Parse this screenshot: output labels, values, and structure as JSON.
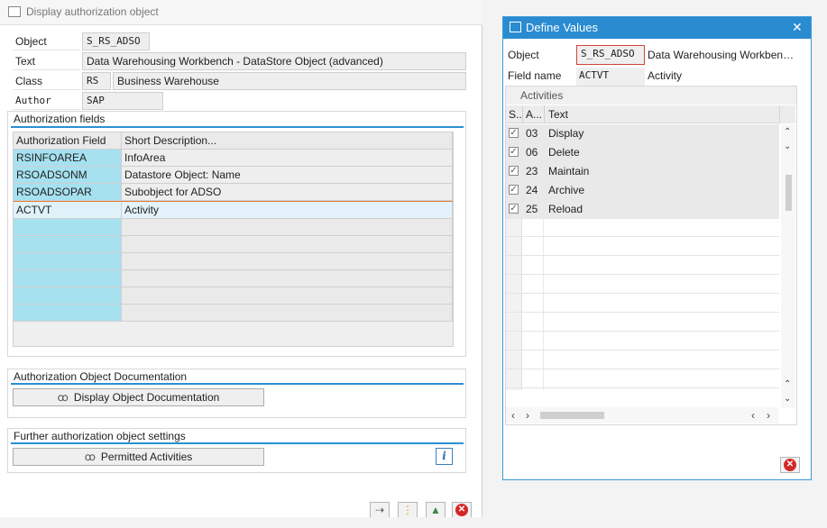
{
  "left_dialog": {
    "title": "Display authorization object",
    "object_label": "Object",
    "object_value": "S_RS_ADSO",
    "text_label": "Text",
    "text_value": "Data Warehousing Workbench - DataStore Object (advanced)",
    "class_label": "Class",
    "class_code": "RS",
    "class_name": "Business Warehouse",
    "author_label": "Author",
    "author_value": "SAP",
    "auth_fields_title": "Authorization fields",
    "col_field": "Authorization Field",
    "col_desc": "Short Description...",
    "rows": [
      {
        "field": "RSINFOAREA",
        "desc": "InfoArea"
      },
      {
        "field": "RSOADSONM",
        "desc": "Datastore Object: Name"
      },
      {
        "field": "RSOADSOPAR",
        "desc": "Subobject for ADSO"
      },
      {
        "field": "ACTVT",
        "desc": "Activity"
      }
    ],
    "doc_title": "Authorization Object Documentation",
    "doc_button": "Display Object Documentation",
    "further_title": "Further authorization object settings",
    "permitted_button": "Permitted Activities",
    "info_icon": "i",
    "footer_icons": [
      "where-used-icon",
      "hierarchy-icon",
      "transport-icon",
      "cancel-icon"
    ]
  },
  "right_dialog": {
    "title": "Define Values",
    "close_glyph": "✕",
    "object_label": "Object",
    "object_value": "S_RS_ADSO",
    "object_text": "Data Warehousing Workben…",
    "field_label": "Field name",
    "field_value": "ACTVT",
    "field_text": "Activity",
    "group_title": "Activities",
    "col_s": "S..",
    "col_a": "A...",
    "col_text": "Text",
    "activities": [
      {
        "code": "03",
        "text": "Display",
        "checked": true
      },
      {
        "code": "06",
        "text": "Delete",
        "checked": true
      },
      {
        "code": "23",
        "text": "Maintain",
        "checked": true
      },
      {
        "code": "24",
        "text": "Archive",
        "checked": true
      },
      {
        "code": "25",
        "text": "Reload",
        "checked": true
      }
    ],
    "check_glyph": "✓"
  },
  "colors": {
    "accent_blue": "#2a8bd1",
    "key_cell": "#a6e1f0",
    "cancel_red": "#d42727"
  }
}
